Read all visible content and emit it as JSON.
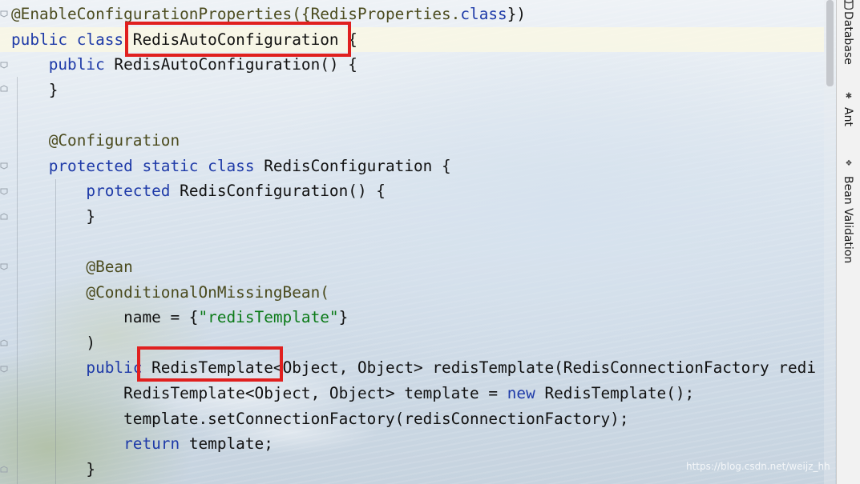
{
  "editor": {
    "lines": [
      [
        {
          "t": "@EnableConfigurationProperties({RedisProperties.",
          "c": "ann"
        },
        {
          "t": "class",
          "c": "kw"
        },
        {
          "t": "})",
          "c": "plain"
        }
      ],
      [
        {
          "t": "public class ",
          "c": "kw"
        },
        {
          "t": "RedisAutoConfiguration {",
          "c": "plain"
        }
      ],
      [
        {
          "t": "    public ",
          "c": "kw"
        },
        {
          "t": "RedisAutoConfiguration() {",
          "c": "plain"
        }
      ],
      [
        {
          "t": "    }",
          "c": "plain"
        }
      ],
      [
        {
          "t": "",
          "c": "plain"
        }
      ],
      [
        {
          "t": "    @Configuration",
          "c": "ann"
        }
      ],
      [
        {
          "t": "    protected static class ",
          "c": "kw"
        },
        {
          "t": "RedisConfiguration {",
          "c": "plain"
        }
      ],
      [
        {
          "t": "        protected ",
          "c": "kw"
        },
        {
          "t": "RedisConfiguration() {",
          "c": "plain"
        }
      ],
      [
        {
          "t": "        }",
          "c": "plain"
        }
      ],
      [
        {
          "t": "",
          "c": "plain"
        }
      ],
      [
        {
          "t": "        @Bean",
          "c": "ann"
        }
      ],
      [
        {
          "t": "        @ConditionalOnMissingBean(",
          "c": "ann"
        }
      ],
      [
        {
          "t": "            name = {",
          "c": "plain"
        },
        {
          "t": "\"redisTemplate\"",
          "c": "str"
        },
        {
          "t": "}",
          "c": "plain"
        }
      ],
      [
        {
          "t": "        )",
          "c": "plain"
        }
      ],
      [
        {
          "t": "        public ",
          "c": "kw"
        },
        {
          "t": "RedisTemplate<Object, Object> redisTemplate(RedisConnectionFactory redi",
          "c": "plain"
        }
      ],
      [
        {
          "t": "            RedisTemplate<Object, Object> template = ",
          "c": "plain"
        },
        {
          "t": "new ",
          "c": "kw"
        },
        {
          "t": "RedisTemplate();",
          "c": "plain"
        }
      ],
      [
        {
          "t": "            template.setConnectionFactory(redisConnectionFactory);",
          "c": "plain"
        }
      ],
      [
        {
          "t": "            return ",
          "c": "kw"
        },
        {
          "t": "template;",
          "c": "plain"
        }
      ],
      [
        {
          "t": "        }",
          "c": "plain"
        }
      ]
    ],
    "colors": {
      "keyword": "#1e3aa8",
      "string": "#0b7a18",
      "annotation": "#4b4b1e",
      "highlight_box": "#e0201f"
    }
  },
  "tool_windows": [
    {
      "label": "Database",
      "icon": "database-icon",
      "glyph": ""
    },
    {
      "label": "Ant",
      "icon": "ant-icon",
      "glyph": "✱"
    },
    {
      "label": "Bean Validation",
      "icon": "bean-validation-icon",
      "glyph": "❖"
    }
  ],
  "watermark": "https://blog.csdn.net/weijz_hh"
}
